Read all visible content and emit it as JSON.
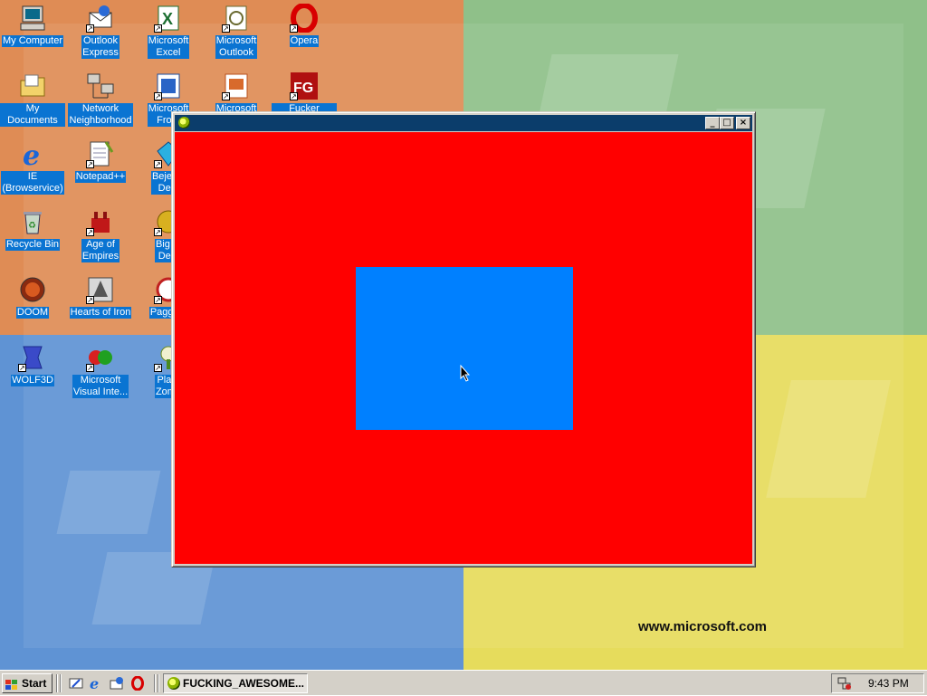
{
  "desktop": {
    "website_text": "www.microsoft.com",
    "icons": [
      {
        "label": "My Computer",
        "icon": "my-computer-icon"
      },
      {
        "label": "Outlook\nExpress",
        "icon": "outlook-express-icon"
      },
      {
        "label": "Microsoft\nExcel",
        "icon": "excel-icon"
      },
      {
        "label": "Microsoft\nOutlook",
        "icon": "outlook-icon"
      },
      {
        "label": "Opera",
        "icon": "opera-icon"
      },
      {
        "label": "My Documents",
        "icon": "my-documents-icon"
      },
      {
        "label": "Network\nNeighborhood",
        "icon": "network-icon"
      },
      {
        "label": "Microsoft\nFront",
        "icon": "frontpage-icon"
      },
      {
        "label": "Microsoft",
        "icon": "powerpoint-icon"
      },
      {
        "label": "Fucker Google",
        "icon": "fucker-google-icon"
      },
      {
        "label": "IE\n(Browservice)",
        "icon": "ie-icon"
      },
      {
        "label": "Notepad++",
        "icon": "notepad-icon"
      },
      {
        "label": "Bejewe\nDelu",
        "icon": "bejeweled-icon"
      },
      {
        "label": "Recycle Bin",
        "icon": "recycle-bin-icon"
      },
      {
        "label": "Age of\nEmpires",
        "icon": "age-of-empires-icon"
      },
      {
        "label": "Big M\nDelu",
        "icon": "game-icon"
      },
      {
        "label": "DOOM",
        "icon": "doom-icon"
      },
      {
        "label": "Hearts of Iron",
        "icon": "hearts-of-iron-icon"
      },
      {
        "label": "Paggle I",
        "icon": "peggle-icon"
      },
      {
        "label": "WOLF3D",
        "icon": "wolf3d-icon"
      },
      {
        "label": "Microsoft\nVisual Inte...",
        "icon": "visual-interdev-icon"
      },
      {
        "label": "Plant\nZomb",
        "icon": "plants-zombies-icon"
      }
    ]
  },
  "window": {
    "title": "",
    "client_color": "#ff0000",
    "rect_color": "#0080ff",
    "titlebar_color": "#0b3d6b"
  },
  "taskbar": {
    "start_label": "Start",
    "task_label": "FUCKING_AWESOME...",
    "clock": "9:43 PM",
    "quick_launch": [
      "show-desktop-icon",
      "ie-icon",
      "outlook-express-icon",
      "opera-icon"
    ]
  }
}
